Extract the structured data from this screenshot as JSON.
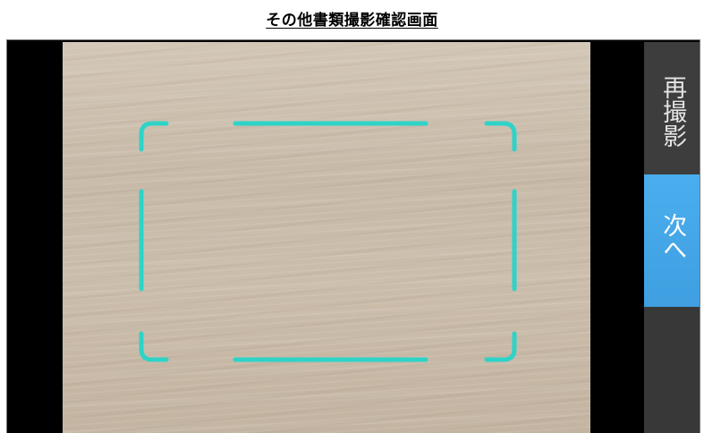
{
  "page": {
    "title": "その他書類撮影確認画面"
  },
  "controls": {
    "retake_label": "再撮影",
    "next_label": "次へ"
  },
  "colors": {
    "guide_frame": "#2ed3c8",
    "next_button": "#45a6e6",
    "side_panel": "#3b3b3b",
    "letterbox": "#000000"
  },
  "icons": {
    "guide_frame": "capture-guide-frame-icon"
  }
}
